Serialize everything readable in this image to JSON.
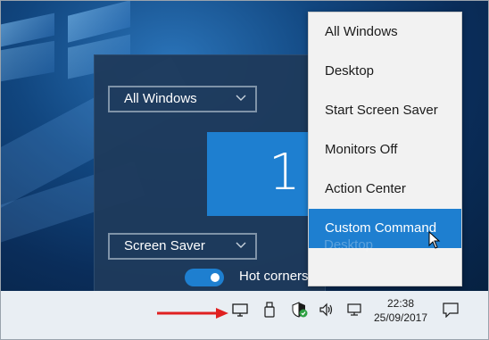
{
  "settings_panel": {
    "monitor_select": "All Windows",
    "action_select": "Screen Saver",
    "monitor_number": "1",
    "hot_corners_label": "Hot corners",
    "hot_corners_enabled": true
  },
  "context_menu": {
    "items": [
      {
        "label": "All Windows",
        "selected": false
      },
      {
        "label": "Desktop",
        "selected": false
      },
      {
        "label": "Start Screen Saver",
        "selected": false
      },
      {
        "label": "Monitors Off",
        "selected": false
      },
      {
        "label": "Action Center",
        "selected": false
      },
      {
        "label": "Custom Command",
        "selected": true
      }
    ],
    "ghost_label": "Desktop"
  },
  "taskbar": {
    "time": "22:38",
    "date": "25/09/2017",
    "tray_icons": [
      "monitor-icon",
      "usb-drive-icon",
      "security-shield-icon",
      "volume-icon",
      "network-icon",
      "notification-icon"
    ]
  },
  "colors": {
    "accent": "#1e7fd0",
    "annotation_arrow": "#e02020",
    "taskbar": "#e9eef3",
    "menu_bg": "#f2f2f2"
  }
}
